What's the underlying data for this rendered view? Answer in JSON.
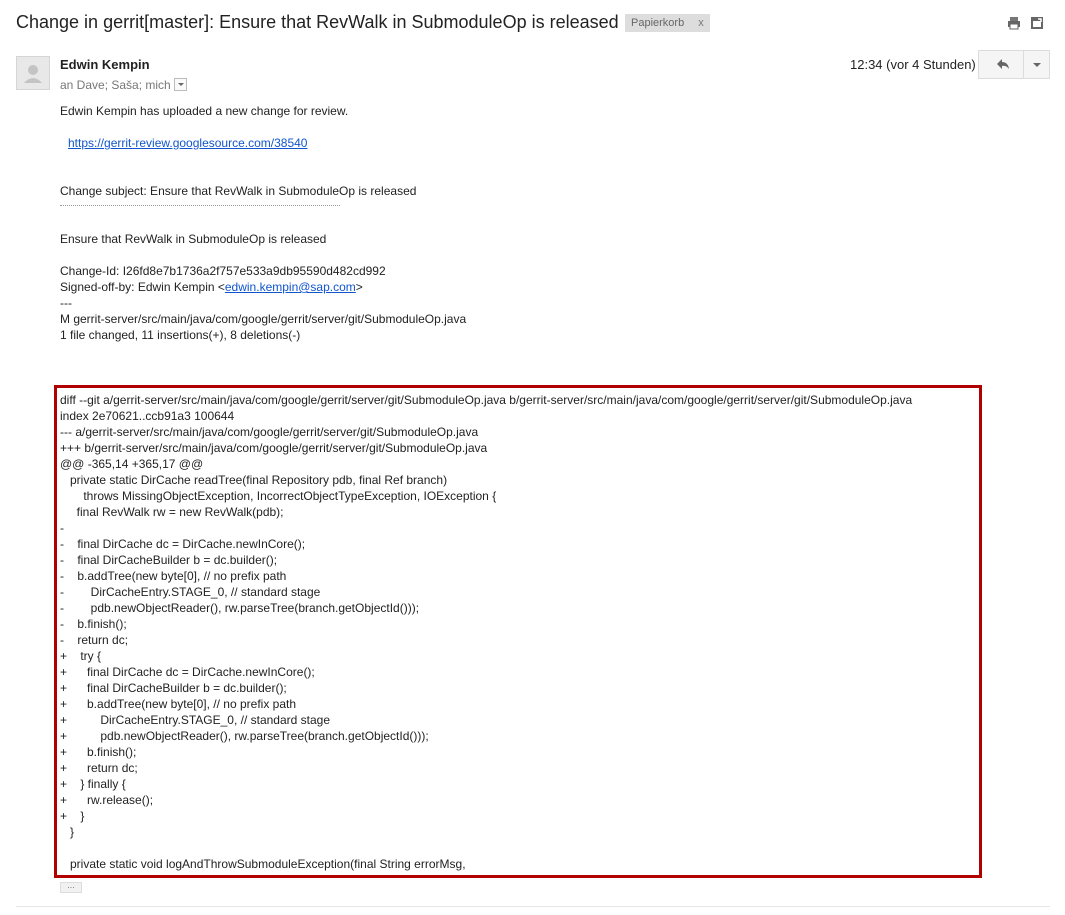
{
  "header": {
    "subject": "Change in gerrit[master]: Ensure that RevWalk in SubmoduleOp is released",
    "label": "Papierkorb",
    "label_remove": "x",
    "icons": [
      "print-icon",
      "new-window-icon"
    ]
  },
  "message": {
    "sender": "Edwin Kempin",
    "recipients": "an Dave; Saša; mich",
    "date": "12:34 (vor 4 Stunden)",
    "reply_icon": "reply-icon",
    "more_icon": "chevron-down-icon",
    "intro": "Edwin Kempin has uploaded a new change for review.",
    "link": "https://gerrit-review.googlesource.com/38540",
    "change_subject": "Change subject: Ensure that RevWalk in SubmoduleOp is released",
    "commit_title": "Ensure that RevWalk in SubmoduleOp is released",
    "change_id": "Change-Id: I26fd8e7b1736a2f757e533a9db95590d482cd992",
    "signed_off_prefix": "Signed-off-by: Edwin Kempin <",
    "signed_off_email": "edwin.kempin@sap.com",
    "signed_off_suffix": ">",
    "separator": "---",
    "file_modified": "M gerrit-server/src/main/java/com/google/gerrit/server/git/SubmoduleOp.java",
    "stats": "1 file changed, 11 insertions(+), 8 deletions(-)"
  },
  "diff": {
    "lines": [
      "diff --git a/gerrit-server/src/main/java/com/google/gerrit/server/git/SubmoduleOp.java b/gerrit-server/src/main/java/com/google/gerrit/server/git/SubmoduleOp.java",
      "index 2e70621..ccb91a3 100644",
      "--- a/gerrit-server/src/main/java/com/google/gerrit/server/git/SubmoduleOp.java",
      "+++ b/gerrit-server/src/main/java/com/google/gerrit/server/git/SubmoduleOp.java",
      "@@ -365,14 +365,17 @@",
      "   private static DirCache readTree(final Repository pdb, final Ref branch)",
      "       throws MissingObjectException, IncorrectObjectTypeException, IOException {",
      "     final RevWalk rw = new RevWalk(pdb);",
      "-",
      "-    final DirCache dc = DirCache.newInCore();",
      "-    final DirCacheBuilder b = dc.builder();",
      "-    b.addTree(new byte[0], // no prefix path",
      "-        DirCacheEntry.STAGE_0, // standard stage",
      "-        pdb.newObjectReader(), rw.parseTree(branch.getObjectId()));",
      "-    b.finish();",
      "-    return dc;",
      "+    try {",
      "+      final DirCache dc = DirCache.newInCore();",
      "+      final DirCacheBuilder b = dc.builder();",
      "+      b.addTree(new byte[0], // no prefix path",
      "+          DirCacheEntry.STAGE_0, // standard stage",
      "+          pdb.newObjectReader(), rw.parseTree(branch.getObjectId()));",
      "+      b.finish();",
      "+      return dc;",
      "+    } finally {",
      "+      rw.release();",
      "+    }",
      "   }",
      "",
      "   private static void logAndThrowSubmoduleException(final String errorMsg,"
    ]
  },
  "trim": {
    "label": "..."
  }
}
